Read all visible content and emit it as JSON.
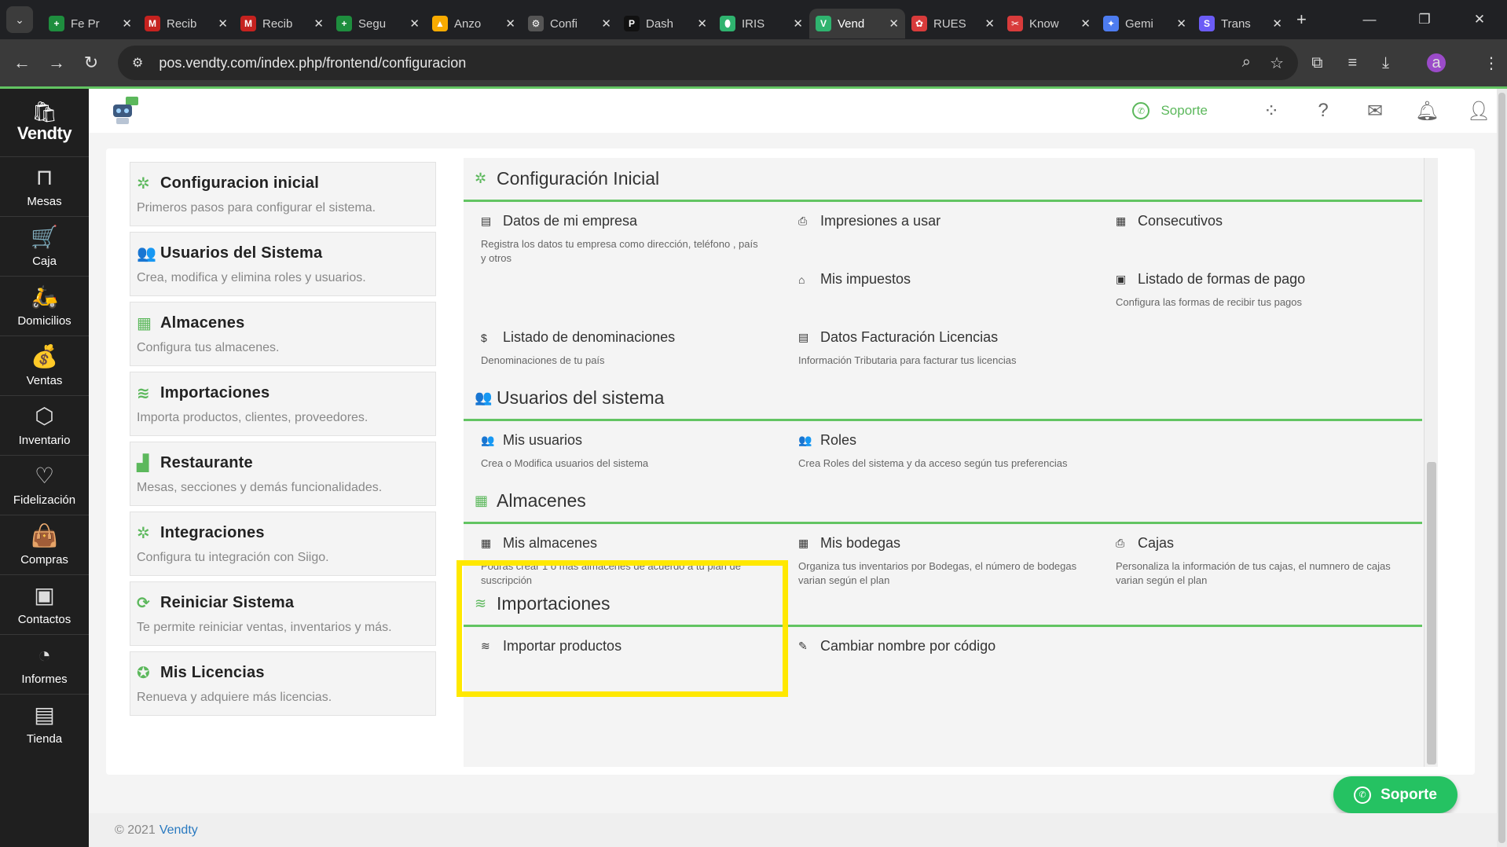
{
  "browser": {
    "tabs": [
      {
        "title": "Fe Pr",
        "fav": "+",
        "color": "#1e8e3e"
      },
      {
        "title": "Recib",
        "fav": "M",
        "color": "#c5221f"
      },
      {
        "title": "Recib",
        "fav": "M",
        "color": "#c5221f"
      },
      {
        "title": "Segu",
        "fav": "+",
        "color": "#1e8e3e"
      },
      {
        "title": "Anzo",
        "fav": "▲",
        "color": "#f9ab00"
      },
      {
        "title": "Confi",
        "fav": "⚙",
        "color": "#555555"
      },
      {
        "title": "Dash",
        "fav": "P",
        "color": "#111111"
      },
      {
        "title": "IRIS",
        "fav": "⬮",
        "color": "#2fb36f"
      },
      {
        "title": "Vend",
        "fav": "V",
        "color": "#2fb36f",
        "active": true
      },
      {
        "title": "RUES",
        "fav": "✿",
        "color": "#d83b3b"
      },
      {
        "title": "Know",
        "fav": "✂",
        "color": "#d83b3b"
      },
      {
        "title": "Gemi",
        "fav": "✦",
        "color": "#4d7cf0"
      },
      {
        "title": "Trans",
        "fav": "S",
        "color": "#6b5cf6"
      }
    ],
    "url": "pos.vendty.com/index.php/frontend/configuracion",
    "profile_initial": "a"
  },
  "sidebar": {
    "brand": "Vendty",
    "items": [
      {
        "label": "Mesas",
        "icon": "table-icon",
        "glyph": "⊓"
      },
      {
        "label": "Caja",
        "icon": "cart-icon",
        "glyph": "🛒"
      },
      {
        "label": "Domicilios",
        "icon": "scooter-icon",
        "glyph": "🛵"
      },
      {
        "label": "Ventas",
        "icon": "moneybag-icon",
        "glyph": "💰"
      },
      {
        "label": "Inventario",
        "icon": "box-icon",
        "glyph": "⬡"
      },
      {
        "label": "Fidelización",
        "icon": "heart-icon",
        "glyph": "♡"
      },
      {
        "label": "Compras",
        "icon": "shopping-bag-icon",
        "glyph": "👜"
      },
      {
        "label": "Contactos",
        "icon": "contacts-icon",
        "glyph": "▣"
      },
      {
        "label": "Informes",
        "icon": "pie-chart-icon",
        "glyph": "◔"
      },
      {
        "label": "Tienda",
        "icon": "store-icon",
        "glyph": "▤"
      }
    ]
  },
  "header": {
    "support_label": "Soporte"
  },
  "left_menu": [
    {
      "title": "Configuracion inicial",
      "desc": "Primeros pasos para configurar el sistema.",
      "icon": "gear-icon",
      "glyph": "✲"
    },
    {
      "title": "Usuarios del Sistema",
      "desc": "Crea, modifica y elimina roles y usuarios.",
      "icon": "users-icon",
      "glyph": "👥"
    },
    {
      "title": "Almacenes",
      "desc": "Configura tus almacenes.",
      "icon": "warehouse-icon",
      "glyph": "▦"
    },
    {
      "title": "Importaciones",
      "desc": "Importa productos, clientes, proveedores.",
      "icon": "stack-icon",
      "glyph": "≋"
    },
    {
      "title": "Restaurante",
      "desc": "Mesas, secciones y demás funcionalidades.",
      "icon": "restaurant-icon",
      "glyph": "▟"
    },
    {
      "title": "Integraciones",
      "desc": "Configura tu integración con Siigo.",
      "icon": "integrations-icon",
      "glyph": "✲"
    },
    {
      "title": "Reiniciar Sistema",
      "desc": "Te permite reiniciar ventas, inventarios y más.",
      "icon": "reset-icon",
      "glyph": "⟳"
    },
    {
      "title": "Mis Licencias",
      "desc": "Renueva y adquiere más licencias.",
      "icon": "award-icon",
      "glyph": "✪"
    }
  ],
  "sections": [
    {
      "title": "Configuración Inicial",
      "icon": "gear-icon",
      "glyph": "✲",
      "items": [
        {
          "title": "Datos de mi empresa",
          "desc": "Registra los datos tu empresa como dirección, teléfono , país y otros",
          "glyph": "▤"
        },
        {
          "title": "Impresiones a usar",
          "desc": "",
          "glyph": "⎙"
        },
        {
          "title": "Consecutivos",
          "desc": "",
          "glyph": "▦"
        },
        {
          "title": "",
          "desc": "",
          "glyph": ""
        },
        {
          "title": "Mis impuestos",
          "desc": "",
          "glyph": "⌂"
        },
        {
          "title": "Listado de formas de pago",
          "desc": "Configura las formas de recibir tus pagos",
          "glyph": "▣"
        },
        {
          "title": "Listado de denominaciones",
          "desc": "Denominaciones de tu país",
          "glyph": "$"
        },
        {
          "title": "Datos Facturación Licencias",
          "desc": "Información Tributaria para facturar tus licencias",
          "glyph": "▤"
        }
      ]
    },
    {
      "title": "Usuarios del sistema",
      "icon": "users-icon",
      "glyph": "👥",
      "items": [
        {
          "title": "Mis usuarios",
          "desc": "Crea o Modifica usuarios del sistema",
          "glyph": "👥"
        },
        {
          "title": "Roles",
          "desc": "Crea Roles del sistema y da acceso según tus preferencias",
          "glyph": "👥"
        }
      ]
    },
    {
      "title": "Almacenes",
      "icon": "warehouse-icon",
      "glyph": "▦",
      "items": [
        {
          "title": "Mis almacenes",
          "desc": "Podras crear 1 o mas almacenes de acuerdo a tu plan de suscripción",
          "glyph": "▦"
        },
        {
          "title": "Mis bodegas",
          "desc": "Organiza tus inventarios por Bodegas, el número de bodegas varian según el plan",
          "glyph": "▦"
        },
        {
          "title": "Cajas",
          "desc": "Personaliza la información de tus cajas, el numnero de cajas varian según el plan",
          "glyph": "⎙"
        }
      ]
    },
    {
      "title": "Importaciones",
      "icon": "stack-icon",
      "glyph": "≋",
      "items": [
        {
          "title": "Importar productos",
          "desc": "",
          "glyph": "≋"
        },
        {
          "title": "Cambiar nombre por código",
          "desc": "",
          "glyph": "✎"
        }
      ]
    }
  ],
  "whatsapp_button": "Soporte",
  "footer": {
    "copyright": "© 2021",
    "brand": "Vendty"
  },
  "colors": {
    "accent": "#62c462",
    "highlight": "#ffe800",
    "whatsapp": "#25c262"
  }
}
